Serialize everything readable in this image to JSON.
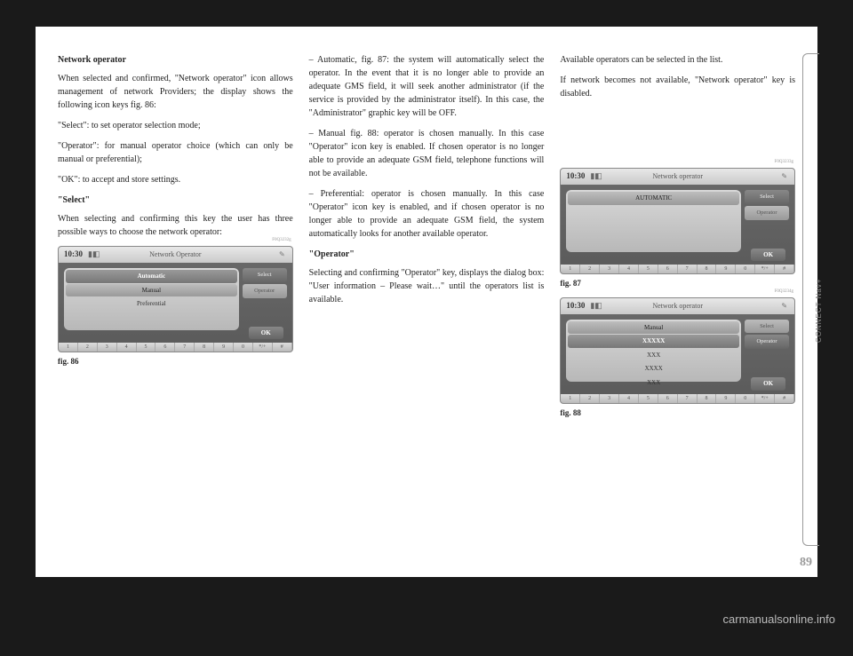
{
  "col1": {
    "heading": "Network operator",
    "p1": "When selected and confirmed, \"Network operator\" icon allows management of network Providers; the display shows the following icon keys fig. 86:",
    "p2": "\"Select\": to set operator selection mode;",
    "p3": "\"Operator\": for manual operator choice (which can only be manual or preferential);",
    "p4": "\"OK\": to accept and store settings.",
    "sub1": "\"Select\"",
    "p5": "When selecting and confirming this key the user has three possible ways to choose the network operator:"
  },
  "col2": {
    "p1": "– Automatic, fig. 87: the system will automatically select the operator. In the event that it is no longer able to provide an adequate GMS field, it will seek another administrator (if the service is provided by the administrator itself). In this case, the \"Administrator\" graphic key will be OFF.",
    "p2": "– Manual fig. 88: operator is chosen manually. In this case \"Operator\" icon key is enabled. If chosen operator is no longer able to provide an adequate GSM field, telephone functions will not be available.",
    "p3": "– Preferential: operator is chosen manually. In this case \"Operator\" icon key is enabled, and if chosen operator is no longer able to provide an adequate GSM field, the system automatically looks for another available operator.",
    "sub1": "\"Operator\"",
    "p4": "Selecting and confirming \"Operator\" key, displays the dialog box: \"User information – Please wait…\" until the operators list is available."
  },
  "col3": {
    "p1": "Available operators can be selected in the list.",
    "p2": "If network becomes not available, \"Network operator\" key is disabled."
  },
  "screens": {
    "time": "10:30",
    "title86": "Network Operator",
    "title87": "Network operator",
    "title88": "Network operator",
    "automatic": "Automatic",
    "automatic_caps": "AUTOMATIC",
    "manual": "Manual",
    "preferential": "Preferential",
    "select": "Select",
    "operator": "Operator",
    "ok": "OK",
    "xxxxx": "XXXXX",
    "xxx": "XXX",
    "xxxx": "XXXX",
    "keys": [
      "1",
      "2",
      "3",
      "4",
      "5",
      "6",
      "7",
      "8",
      "9",
      "0",
      "*/+",
      "#"
    ],
    "code86": "F0Q3232g",
    "code87": "F0Q3233g",
    "code88": "F0Q3234g"
  },
  "labels": {
    "fig86": "fig. 86",
    "fig87": "fig. 87",
    "fig88": "fig. 88"
  },
  "sidetab": "CONNECT Nav+",
  "pagenum": "89",
  "watermark": "carmanualsonline.info"
}
